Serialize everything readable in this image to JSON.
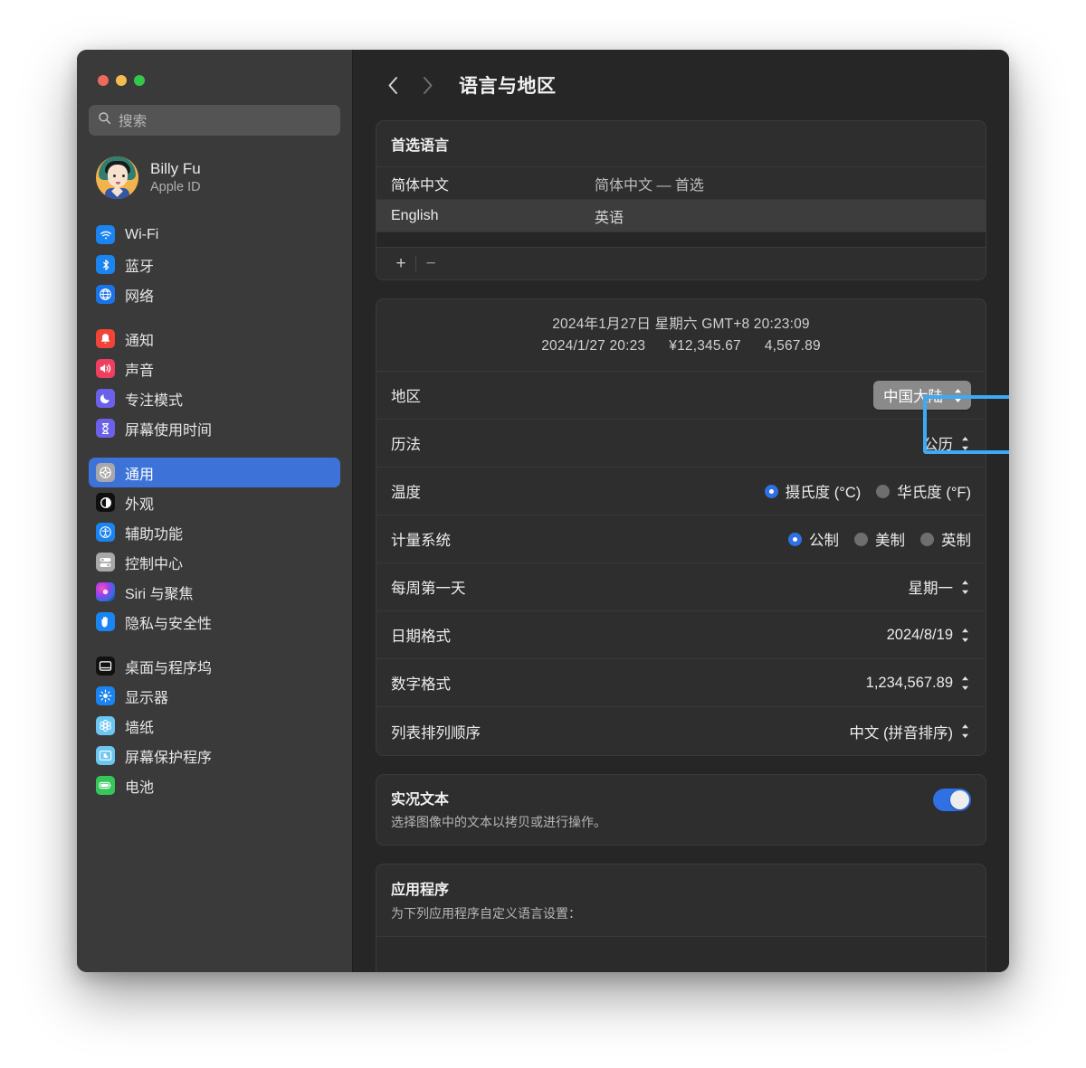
{
  "window": {
    "traffic_lights": [
      "close",
      "minimize",
      "zoom"
    ],
    "colors": {
      "accent": "#2f71e4",
      "sidebar_selected": "#3d73d8",
      "highlight_ring": "#3fa9f5"
    }
  },
  "sidebar": {
    "search": {
      "placeholder": "搜索",
      "icon": "search-icon"
    },
    "account": {
      "name": "Billy Fu",
      "subtitle": "Apple ID"
    },
    "groups": [
      {
        "items": [
          {
            "label": "Wi-Fi",
            "icon": "wifi-icon"
          },
          {
            "label": "蓝牙",
            "icon": "bluetooth-icon"
          },
          {
            "label": "网络",
            "icon": "network-globe-icon"
          }
        ]
      },
      {
        "items": [
          {
            "label": "通知",
            "icon": "notifications-bell-icon"
          },
          {
            "label": "声音",
            "icon": "sound-speaker-icon"
          },
          {
            "label": "专注模式",
            "icon": "focus-moon-icon"
          },
          {
            "label": "屏幕使用时间",
            "icon": "screen-time-hourglass-icon"
          }
        ]
      },
      {
        "items": [
          {
            "label": "通用",
            "icon": "general-gear-icon",
            "selected": true
          },
          {
            "label": "外观",
            "icon": "appearance-contrast-icon"
          },
          {
            "label": "辅助功能",
            "icon": "accessibility-icon"
          },
          {
            "label": "控制中心",
            "icon": "control-center-icon"
          },
          {
            "label": "Siri 与聚焦",
            "icon": "siri-icon"
          },
          {
            "label": "隐私与安全性",
            "icon": "privacy-hand-icon"
          }
        ]
      },
      {
        "items": [
          {
            "label": "桌面与程序坞",
            "icon": "desktop-dock-icon"
          },
          {
            "label": "显示器",
            "icon": "displays-brightness-icon"
          },
          {
            "label": "墙纸",
            "icon": "wallpaper-flower-icon"
          },
          {
            "label": "屏幕保护程序",
            "icon": "screensaver-icon"
          },
          {
            "label": "电池",
            "icon": "battery-icon"
          }
        ]
      }
    ]
  },
  "toolbar": {
    "back_icon": "chevron-left-icon",
    "forward_icon": "chevron-right-icon",
    "title": "语言与地区"
  },
  "preferred_languages": {
    "header": "首选语言",
    "rows": [
      {
        "name": "简体中文",
        "description": "简体中文 — 首选",
        "selected": false
      },
      {
        "name": "English",
        "description": "英语",
        "selected": true
      }
    ],
    "add_label": "+",
    "remove_label": "−"
  },
  "formats": {
    "preview_line1": "2024年1月27日 星期六 GMT+8 20:23:09",
    "preview_date": "2024/1/27 20:23",
    "preview_currency": "¥12,345.67",
    "preview_number": "4,567.89",
    "rows": [
      {
        "label": "地区",
        "type": "popup-pill",
        "value": "中国大陆",
        "highlighted": true
      },
      {
        "label": "历法",
        "type": "popup-plain",
        "value": "公历"
      },
      {
        "label": "温度",
        "type": "radio",
        "options": [
          {
            "label": "摄氏度 (°C)",
            "selected": true
          },
          {
            "label": "华氏度 (°F)",
            "selected": false
          }
        ]
      },
      {
        "label": "计量系统",
        "type": "radio",
        "options": [
          {
            "label": "公制",
            "selected": true
          },
          {
            "label": "美制",
            "selected": false
          },
          {
            "label": "英制",
            "selected": false
          }
        ]
      },
      {
        "label": "每周第一天",
        "type": "popup-plain",
        "value": "星期一"
      },
      {
        "label": "日期格式",
        "type": "popup-plain",
        "value": "2024/8/19"
      },
      {
        "label": "数字格式",
        "type": "popup-plain",
        "value": "1,234,567.89"
      },
      {
        "label": "列表排列顺序",
        "type": "popup-plain",
        "value": "中文 (拼音排序)"
      }
    ]
  },
  "live_text": {
    "title": "实况文本",
    "subtitle": "选择图像中的文本以拷贝或进行操作。",
    "enabled": true
  },
  "applications": {
    "title": "应用程序",
    "subtitle": "为下列应用程序自定义语言设置：",
    "items": [],
    "add_label": "+",
    "remove_label": "−"
  }
}
